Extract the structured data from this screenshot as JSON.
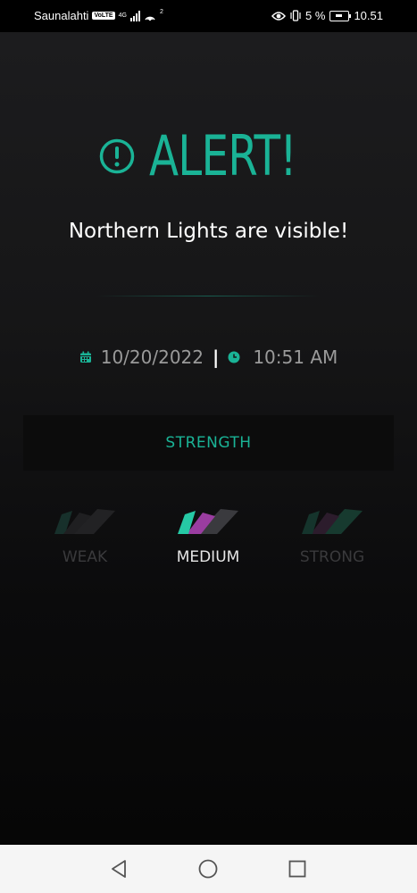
{
  "status_bar": {
    "carrier": "Saunalahti",
    "volte": "VoLTE",
    "network": "4G",
    "hotspot_count": "2",
    "battery": "5 %",
    "time": "10.51"
  },
  "alert": {
    "title": "ALERT!",
    "message": "Northern Lights are visible!",
    "date": "10/20/2022",
    "separator": "|",
    "time": "10:51 AM",
    "accent_color": "#1ab396"
  },
  "strength": {
    "label": "STRENGTH",
    "levels": [
      {
        "label": "WEAK",
        "active": false
      },
      {
        "label": "MEDIUM",
        "active": true
      },
      {
        "label": "STRONG",
        "active": false
      }
    ]
  },
  "navigation": {
    "buttons": [
      "back",
      "home",
      "recents"
    ]
  }
}
